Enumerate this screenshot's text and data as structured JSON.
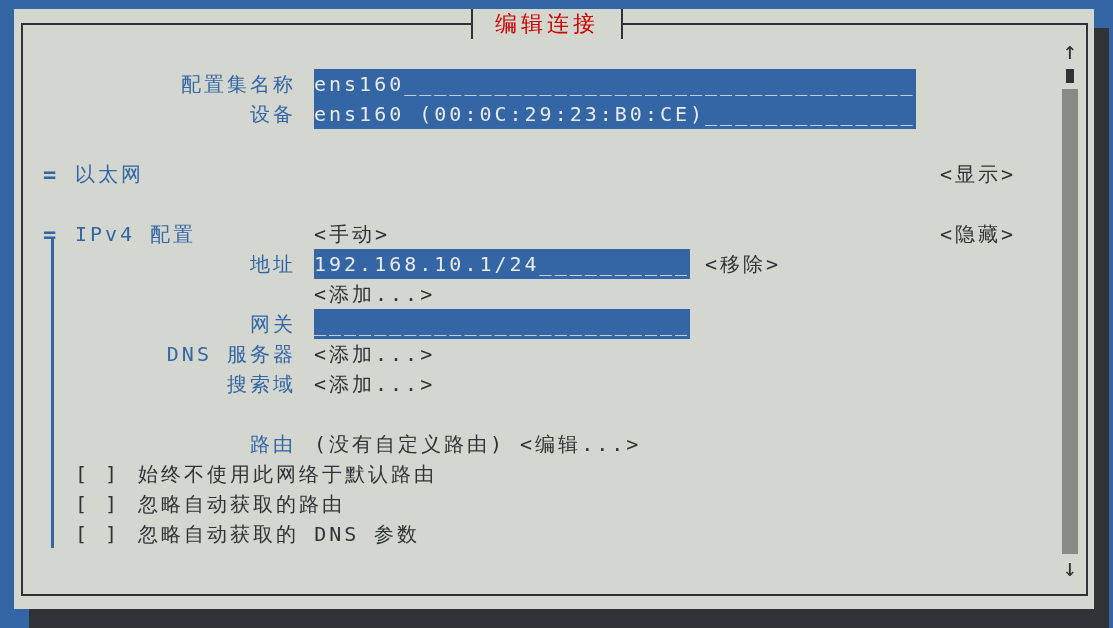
{
  "title": "编辑连接",
  "profile": [
    {
      "label": "配置集名称",
      "value": "ens160__________________________________"
    },
    {
      "label": "设备",
      "value": "ens160 (00:0C:29:23:B0:CE)______________"
    }
  ],
  "sections": [
    {
      "marker": "=",
      "label": "以太网",
      "toggle": "<显示>",
      "expanded": false
    },
    {
      "marker": "=",
      "label": "IPv4 配置",
      "mode": "<手动>",
      "toggle": "<隐藏>",
      "expanded": true,
      "rows": [
        {
          "kind": "field",
          "label": "地址",
          "value": "192.168.10.1/24__________",
          "button": "<移除>"
        },
        {
          "kind": "button",
          "button": "<添加...>"
        },
        {
          "kind": "field",
          "label": "网关",
          "value": "_________________________"
        },
        {
          "kind": "button",
          "label": "DNS 服务器",
          "button": "<添加...>"
        },
        {
          "kind": "button",
          "label": "搜索域",
          "button": "<添加...>"
        },
        {
          "kind": "blank"
        },
        {
          "kind": "routes",
          "label": "路由",
          "value": "(没有自定义路由)",
          "button": "<编辑...>"
        },
        {
          "kind": "checkbox",
          "box": "[ ]",
          "label": "始终不使用此网络于默认路由",
          "checked": false
        },
        {
          "kind": "checkbox",
          "box": "[ ]",
          "label": "忽略自动获取的路由",
          "checked": false
        },
        {
          "kind": "checkbox",
          "box": "[ ]",
          "label": "忽略自动获取的 DNS 参数",
          "checked": false
        }
      ]
    }
  ],
  "scroll": {
    "up": "↑",
    "down": "↓"
  }
}
